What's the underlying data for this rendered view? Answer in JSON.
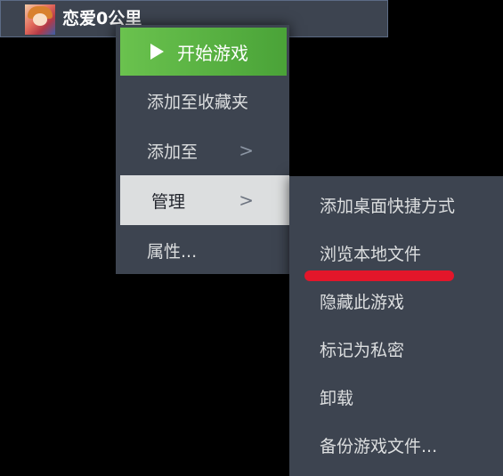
{
  "game": {
    "title": "恋爱0公里",
    "thumbnail_icon": "game-cover-art"
  },
  "context_menu": {
    "play_label": "开始游戏",
    "play_icon": "play-icon",
    "items": [
      {
        "label": "添加至收藏夹"
      },
      {
        "label": "添加至",
        "chevron": ">"
      },
      {
        "label": "管理",
        "chevron": ">"
      },
      {
        "label": "属性..."
      }
    ]
  },
  "manage_submenu": {
    "items": [
      {
        "label": "添加桌面快捷方式"
      },
      {
        "label": "浏览本地文件"
      },
      {
        "label": "隐藏此游戏"
      },
      {
        "label": "标记为私密"
      },
      {
        "label": "卸载"
      },
      {
        "label": "备份游戏文件..."
      }
    ]
  },
  "annotation": {
    "highlight_color": "#e3162a"
  },
  "colors": {
    "menu_bg": "#3d4450",
    "play_green": "#5cb341",
    "active_item_bg": "#dcdedf",
    "text": "#dcdedf"
  }
}
